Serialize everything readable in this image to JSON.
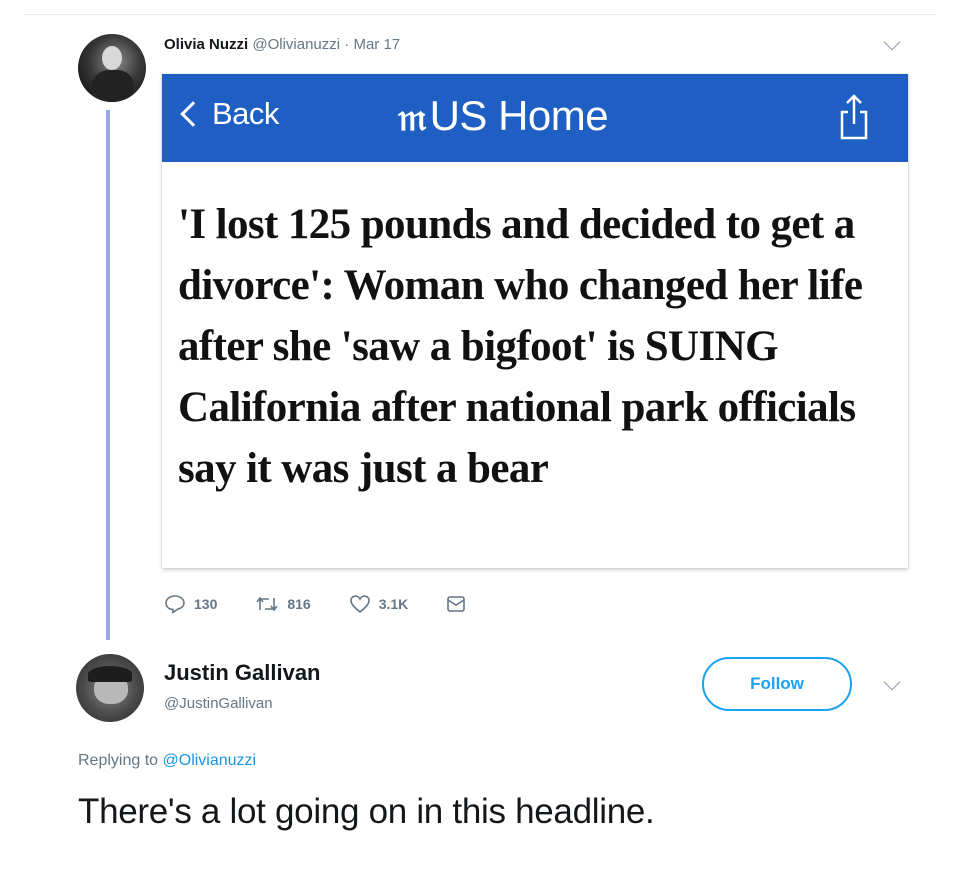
{
  "tweet": {
    "author_name": "Olivia Nuzzi",
    "author_handle": "@Olivianuzzi",
    "separator": "·",
    "date": "Mar 17",
    "avatar_icon": "profile-photo"
  },
  "article_card": {
    "back_label": "Back",
    "brand_mark": "m",
    "section_title": "US Home",
    "share_icon": "share-icon",
    "nav_color": "#1f5fc4",
    "headline": "'I lost 125 pounds and decided to get a divorce': Woman who changed her life after she 'saw a bigfoot' is SUING California after national park officials say it was just a bear"
  },
  "actions": {
    "replies": "130",
    "retweets": "816",
    "likes": "3.1K",
    "icons": [
      "reply-icon",
      "retweet-icon",
      "like-icon",
      "message-icon"
    ]
  },
  "reply": {
    "author_name": "Justin Gallivan",
    "author_handle": "@JustinGallivan",
    "follow_label": "Follow",
    "replying_prefix": "Replying to",
    "replying_handle": "@Olivianuzzi",
    "text": "There's a lot going on in this headline.",
    "accent_color": "#1da1f2"
  }
}
